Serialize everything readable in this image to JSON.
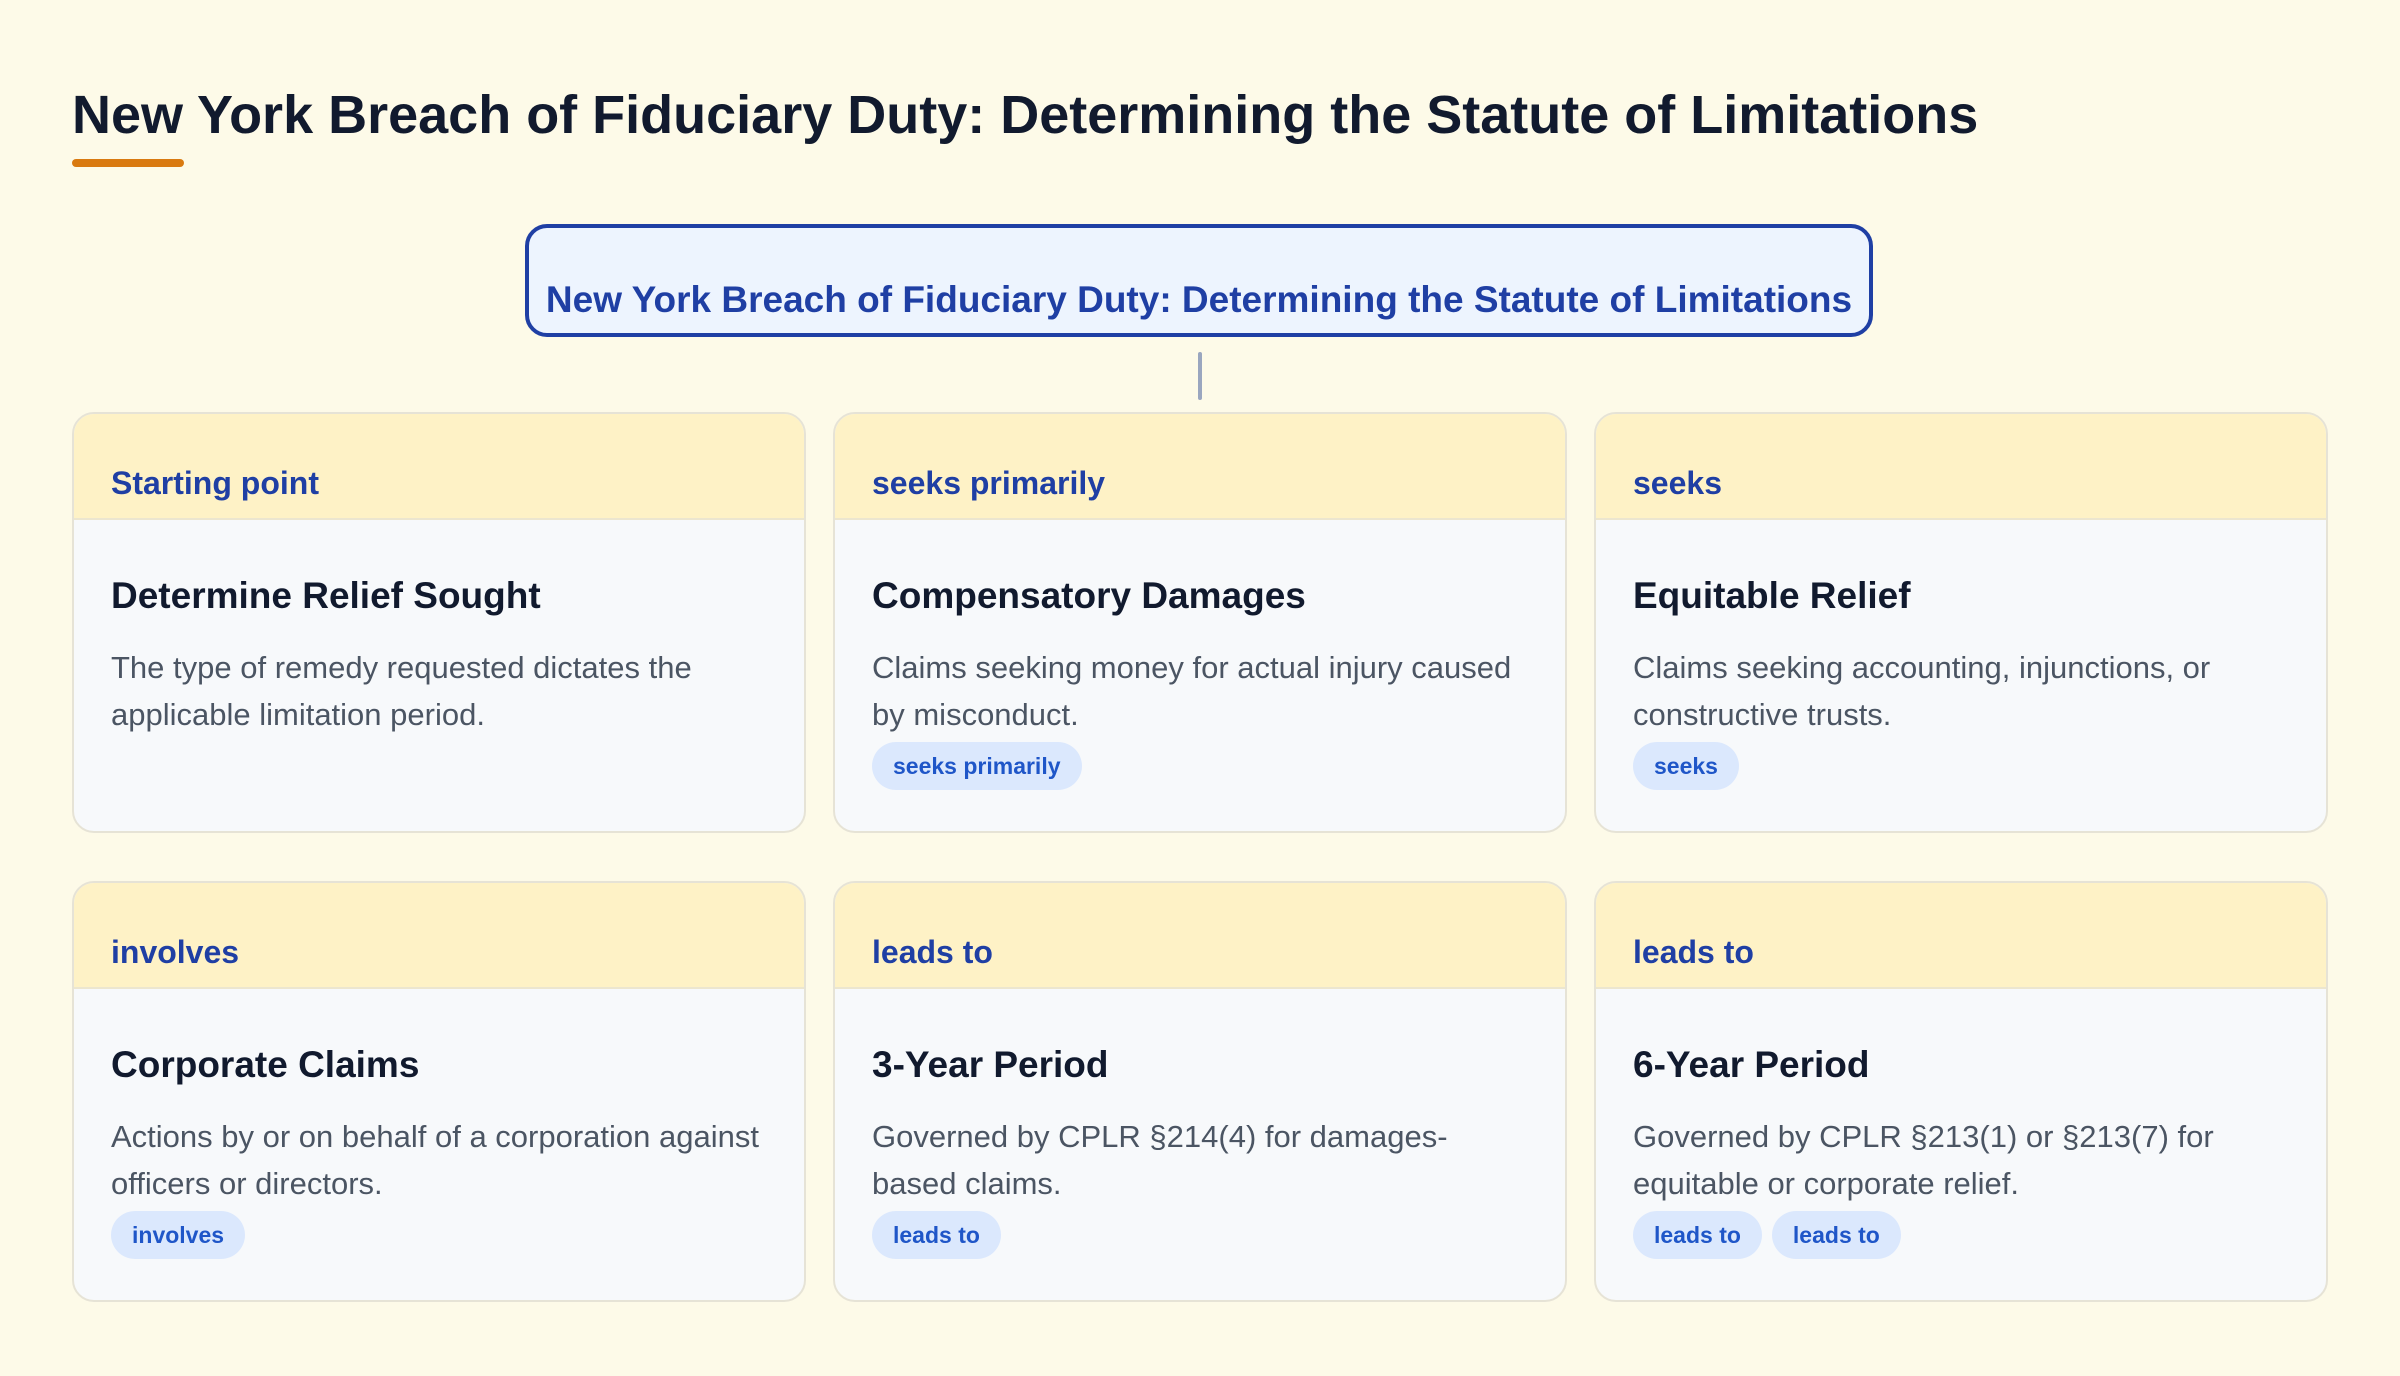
{
  "page": {
    "title": "New York Breach of Fiduciary Duty: Determining the Statute of Limitations",
    "accent_color": "#d97a10"
  },
  "root": {
    "label": "New York Breach of Fiduciary Duty: Determining the Statute of Limitations"
  },
  "cards": [
    {
      "edge_label": "Starting point",
      "title": "Determine Relief Sought",
      "description": "The type of remedy requested dictates the applicable limitation period.",
      "tags": []
    },
    {
      "edge_label": "seeks primarily",
      "title": "Compensatory Damages",
      "description": "Claims seeking money for actual injury caused by misconduct.",
      "tags": [
        "seeks primarily"
      ]
    },
    {
      "edge_label": "seeks",
      "title": "Equitable Relief",
      "description": "Claims seeking accounting, injunctions, or constructive trusts.",
      "tags": [
        "seeks"
      ]
    },
    {
      "edge_label": "involves",
      "title": "Corporate Claims",
      "description": "Actions by or on behalf of a corporation against officers or directors.",
      "tags": [
        "involves"
      ]
    },
    {
      "edge_label": "leads to",
      "title": "3-Year Period",
      "description": "Governed by CPLR §214(4) for damages-based claims.",
      "tags": [
        "leads to"
      ]
    },
    {
      "edge_label": "leads to",
      "title": "6-Year Period",
      "description": "Governed by CPLR §213(1) or §213(7) for equitable or corporate relief.",
      "tags": [
        "leads to",
        "leads to"
      ]
    }
  ]
}
